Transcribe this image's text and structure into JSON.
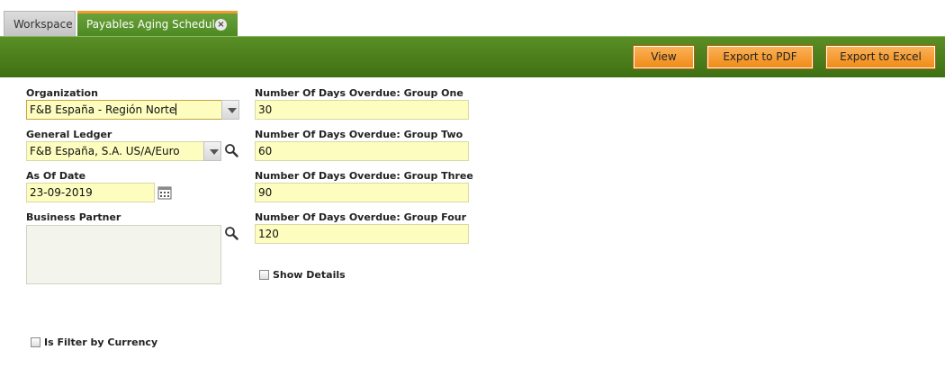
{
  "tabs": [
    {
      "label": "Workspace",
      "active": false
    },
    {
      "label": "Payables Aging Schedule",
      "active": true,
      "close_glyph": "×"
    }
  ],
  "toolbar": {
    "view_label": "View",
    "export_pdf_label": "Export to PDF",
    "export_excel_label": "Export to Excel"
  },
  "form": {
    "organization": {
      "label": "Organization",
      "value": "F&B España - Región Norte"
    },
    "general_ledger": {
      "label": "General Ledger",
      "value": "F&B España, S.A. US/A/Euro"
    },
    "as_of_date": {
      "label": "As Of Date",
      "value": "23-09-2019"
    },
    "business_partner": {
      "label": "Business Partner",
      "value": ""
    },
    "group_one": {
      "label": "Number Of Days Overdue: Group One",
      "value": "30"
    },
    "group_two": {
      "label": "Number Of Days Overdue: Group Two",
      "value": "60"
    },
    "group_three": {
      "label": "Number Of Days Overdue: Group Three",
      "value": "90"
    },
    "group_four": {
      "label": "Number Of Days Overdue: Group Four",
      "value": "120"
    },
    "show_details": {
      "label": "Show Details",
      "checked": false
    },
    "filter_currency": {
      "label": "Is Filter by Currency",
      "checked": false
    }
  },
  "icons": {
    "dropdown": "chevron-down-icon",
    "search": "search-icon",
    "calendar": "calendar-icon",
    "close": "close-icon"
  },
  "colors": {
    "toolbar_green": "#4a7f1c",
    "tab_active_green": "#5a9630",
    "tab_accent_orange": "#f39c2d",
    "button_orange": "#f29a2c",
    "field_yellow": "#fdfdc0"
  }
}
